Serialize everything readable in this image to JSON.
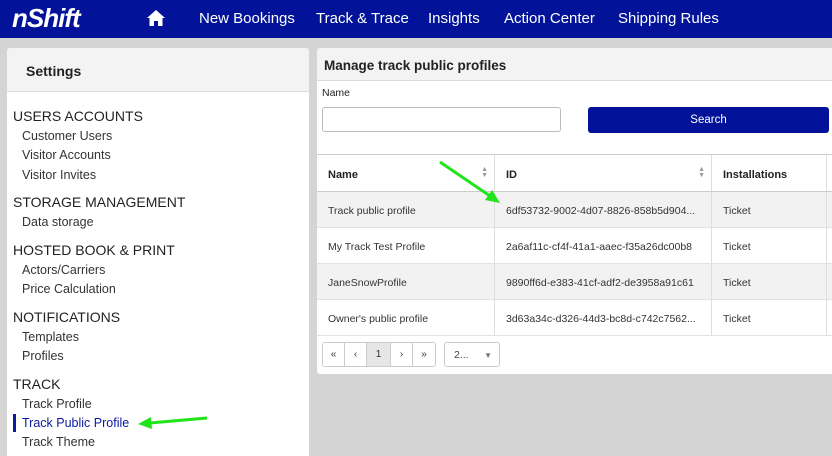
{
  "app": {
    "logo": "nShift"
  },
  "nav": {
    "items": [
      {
        "label": "New Bookings"
      },
      {
        "label": "Track & Trace"
      },
      {
        "label": "Insights"
      },
      {
        "label": "Action Center"
      },
      {
        "label": "Shipping Rules"
      }
    ]
  },
  "sidebar": {
    "title": "Settings",
    "groups": [
      {
        "label": "USERS ACCOUNTS",
        "items": [
          "Customer Users",
          "Visitor Accounts",
          "Visitor Invites"
        ]
      },
      {
        "label": "STORAGE MANAGEMENT",
        "items": [
          "Data storage"
        ]
      },
      {
        "label": "HOSTED BOOK & PRINT",
        "items": [
          "Actors/Carriers",
          "Price Calculation"
        ]
      },
      {
        "label": "NOTIFICATIONS",
        "items": [
          "Templates",
          "Profiles"
        ]
      },
      {
        "label": "TRACK",
        "items": [
          "Track Profile",
          "Track Public Profile",
          "Track Theme"
        ]
      }
    ],
    "active_item": "Track Public Profile"
  },
  "main": {
    "title": "Manage track public profiles",
    "name_label": "Name",
    "name_value": "",
    "search_label": "Search",
    "table": {
      "columns": [
        "Name",
        "ID",
        "Installations"
      ],
      "rows": [
        [
          "Track public profile",
          "6df53732-9002-4d07-8826-858b5d904...",
          "Ticket"
        ],
        [
          "My Track Test Profile",
          "2a6af11c-cf4f-41a1-aaec-f35a26dc00b8",
          "Ticket"
        ],
        [
          "JaneSnowProfile",
          "9890ff6d-e383-41cf-adf2-de3958a91c61",
          "Ticket"
        ],
        [
          "Owner's public profile",
          "3d63a34c-d326-44d3-bc8d-c742c7562...",
          "Ticket"
        ]
      ]
    },
    "pager": {
      "first": "«",
      "prev": "‹",
      "current": "1",
      "next": "›",
      "last": "»",
      "page_size": "2..."
    }
  },
  "colors": {
    "brand": "#02139a",
    "annotation_arrow": "#22e41a"
  }
}
